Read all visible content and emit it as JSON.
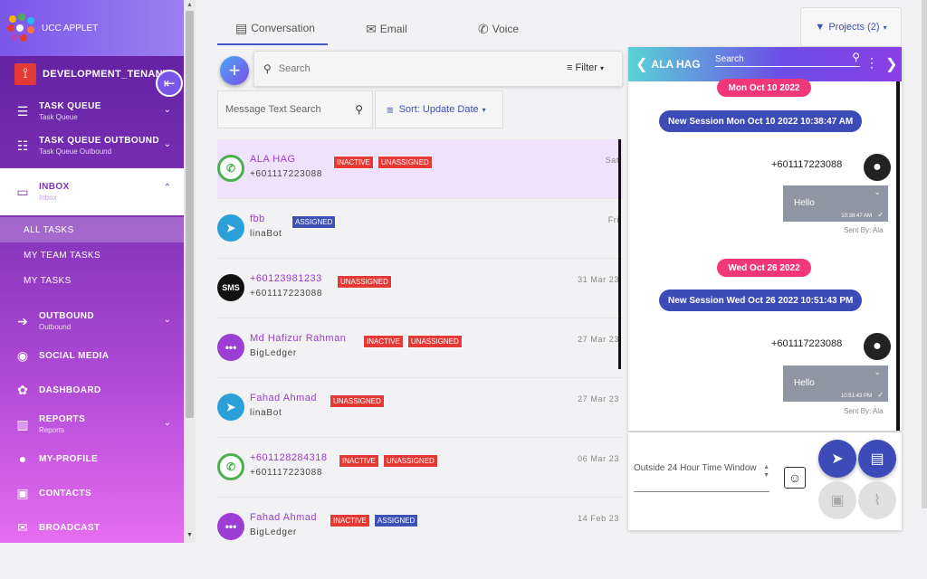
{
  "app": {
    "title": "UCC APPLET"
  },
  "tenant": {
    "name": "DEVELOPMENT_TENANT"
  },
  "sidebar": {
    "items": [
      {
        "label": "TASK QUEUE",
        "sub": "Task Queue",
        "icon": "task-queue-icon"
      },
      {
        "label": "TASK QUEUE OUTBOUND",
        "sub": "Task Queue Outbound",
        "icon": "task-queue-outbound-icon"
      },
      {
        "label": "INBOX",
        "sub": "Inbox",
        "icon": "inbox-icon"
      },
      {
        "label": "OUTBOUND",
        "sub": "Outbound",
        "icon": "arrow-right-icon"
      },
      {
        "label": "SOCIAL MEDIA",
        "sub": "",
        "icon": "play-circle-icon"
      },
      {
        "label": "DASHBOARD",
        "sub": "",
        "icon": "palette-icon"
      },
      {
        "label": "REPORTS",
        "sub": "Reports",
        "icon": "bar-chart-icon"
      },
      {
        "label": "MY-PROFILE",
        "sub": "",
        "icon": "person-icon"
      },
      {
        "label": "CONTACTS",
        "sub": "",
        "icon": "contact-card-icon"
      },
      {
        "label": "BROADCAST",
        "sub": "",
        "icon": "mail-icon"
      }
    ],
    "inbox_sub": [
      "ALL TASKS",
      "MY TEAM TASKS",
      "MY TASKS"
    ]
  },
  "tabs": [
    "Conversation",
    "Email",
    "Voice"
  ],
  "projects_label": "Projects (2)",
  "search": {
    "placeholder": "Search",
    "filter_label": "Filter"
  },
  "message_search": {
    "placeholder": "Message Text Search"
  },
  "sort": {
    "label": "Sort: Update Date"
  },
  "conversations": [
    {
      "name": "ALA HAG",
      "sub": "+601117223088",
      "date": "Sat",
      "channel": "whatsapp",
      "badges": [
        "INACTIVE",
        "UNASSIGNED"
      ]
    },
    {
      "name": "fbb",
      "sub": "linaBot",
      "date": "Fri",
      "channel": "telegram",
      "badges": [
        "ASSIGNED"
      ]
    },
    {
      "name": "+60123981233",
      "sub": "+601117223088",
      "date": "31 Mar 23",
      "channel": "sms",
      "badges": [
        "UNASSIGNED"
      ]
    },
    {
      "name": "Md Hafizur Rahman",
      "sub": "BigLedger",
      "date": "27 Mar 23",
      "channel": "chat",
      "badges": [
        "INACTIVE",
        "UNASSIGNED"
      ]
    },
    {
      "name": "Fahad Ahmad",
      "sub": "linaBot",
      "date": "27 Mar 23",
      "channel": "telegram",
      "badges": [
        "UNASSIGNED"
      ]
    },
    {
      "name": "+601128284318",
      "sub": "+601117223088",
      "date": "06 Mar 23",
      "channel": "whatsapp",
      "badges": [
        "INACTIVE",
        "UNASSIGNED"
      ]
    },
    {
      "name": "Fahad Ahmad",
      "sub": "BigLedger",
      "date": "14 Feb 23",
      "channel": "chat",
      "badges": [
        "INACTIVE",
        "ASSIGNED"
      ]
    }
  ],
  "chat": {
    "contact": "ALA HAG",
    "search_placeholder": "Search",
    "date1": "Mon Oct 10 2022",
    "session1": "New Session Mon Oct 10 2022 10:38:47 AM",
    "date2": "Wed Oct 26 2022",
    "session2": "New Session Wed Oct 26 2022 10:51:43 PM",
    "msg1": {
      "phone": "+601117223088",
      "text": "Hello",
      "time": "10:38:47 AM",
      "sent_by": "Sent By: Ala"
    },
    "msg2": {
      "phone": "+601117223088",
      "text": "Hello",
      "time": "10:51:43 PM",
      "sent_by": "Sent By: Ala"
    },
    "compose_placeholder": "Outside 24 Hour Time Window"
  },
  "colors": {
    "accent": "#3c4bb8",
    "brand": "#7a2fb5",
    "pink": "#f0377a",
    "badge_red": "#e53935",
    "badge_blue": "#3f51b5"
  }
}
